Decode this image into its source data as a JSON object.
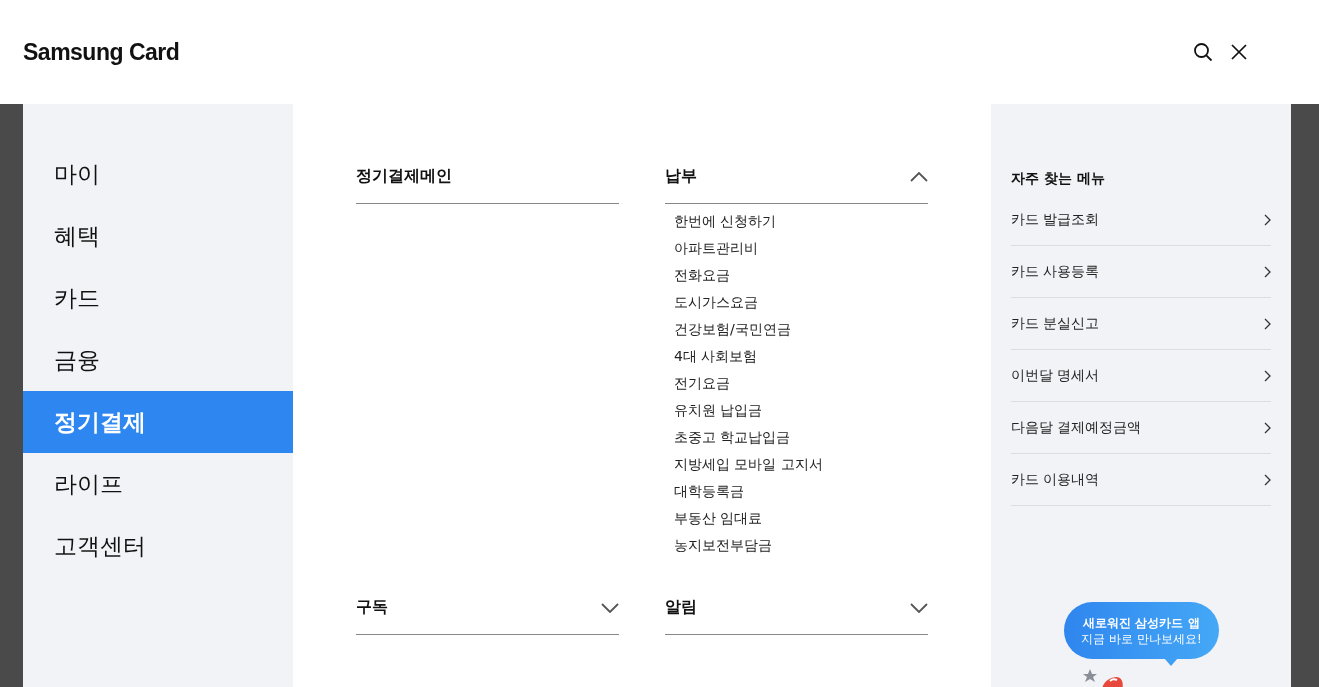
{
  "header": {
    "logo": "Samsung Card"
  },
  "nav": [
    {
      "label": "마이",
      "selected": false
    },
    {
      "label": "혜택",
      "selected": false
    },
    {
      "label": "카드",
      "selected": false
    },
    {
      "label": "금융",
      "selected": false
    },
    {
      "label": "정기결제",
      "selected": true
    },
    {
      "label": "라이프",
      "selected": false
    },
    {
      "label": "고객센터",
      "selected": false
    }
  ],
  "sections": [
    {
      "kind": "link",
      "title": "정기결제메인"
    },
    {
      "kind": "group",
      "title": "납부",
      "expanded": true,
      "items": [
        "한번에 신청하기",
        "아파트관리비",
        "전화요금",
        "도시가스요금",
        "건강보험/국민연금",
        "4대 사회보험",
        "전기요금",
        "유치원 납입금",
        "초중고 학교납입금",
        "지방세입 모바일 고지서",
        "대학등록금",
        "부동산 임대료",
        "농지보전부담금"
      ]
    },
    {
      "kind": "group",
      "title": "구독",
      "expanded": false
    },
    {
      "kind": "group",
      "title": "알림",
      "expanded": false
    }
  ],
  "quick_menu": {
    "title": "자주 찾는 메뉴",
    "items": [
      "카드 발급조회",
      "카드 사용등록",
      "카드 분실신고",
      "이번달 명세서",
      "다음달 결제예정금액",
      "카드 이용내역"
    ]
  },
  "promo": {
    "line_1": "새로워진 삼성카드 앱",
    "line_2": "지금 바로 만나보세요!"
  }
}
